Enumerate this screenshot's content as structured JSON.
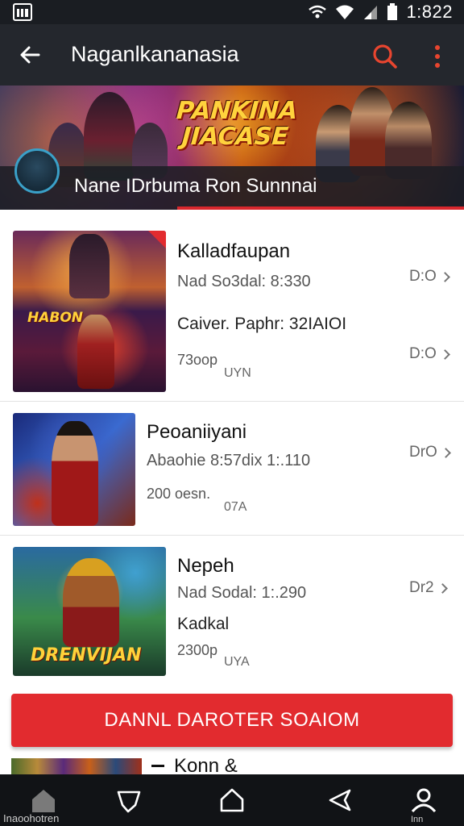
{
  "status_bar": {
    "time": "1:822",
    "icons": [
      "app-gallery-icon",
      "wifi-icon",
      "signal-icon",
      "battery-icon"
    ]
  },
  "app_bar": {
    "title": "Naganlkananasia",
    "back_icon": "arrow-left-icon",
    "search_icon": "search-icon",
    "more_icon": "more-vertical-icon",
    "accent_color": "#e8452f"
  },
  "banner": {
    "headline_line1": "PANKINA",
    "headline_line2": "JIACASE",
    "caption": "Nane IDrbuma Ron Sunnnai",
    "accent_color": "#d8272d"
  },
  "items": [
    {
      "name": "Kalladfaupan",
      "meta": "Nad So3dal: 8:330",
      "line": "Caiver. Paphr: 32IAIOI",
      "count": "73oop",
      "region": "UYN",
      "tag_top": "D:O",
      "tag_bottom": "D:O",
      "thumb_label": "HABON"
    },
    {
      "name": "Peoaniiyani",
      "meta": "Abaohie 8:57dix 1:.110",
      "count": "200 oesn.",
      "region": "07A",
      "tag_top": "DrO"
    },
    {
      "name": "Nepeh",
      "meta": "Nad Sodal: 1:.290",
      "line": "Kadkal",
      "count": "2300p",
      "region": "UYA",
      "tag_top": "Dr2",
      "thumb_label": "DRENVIJAN"
    }
  ],
  "cta": {
    "label": "DANNL DAROTER SOAIOM",
    "color": "#e22b2f"
  },
  "peek_item": {
    "title": "Konn &"
  },
  "bottom_nav": {
    "left_label": "Inaoohotren",
    "right_label": "Inn",
    "icons": [
      "home-icon",
      "tag-icon",
      "house-icon",
      "back-triangle-icon",
      "profile-icon"
    ]
  }
}
